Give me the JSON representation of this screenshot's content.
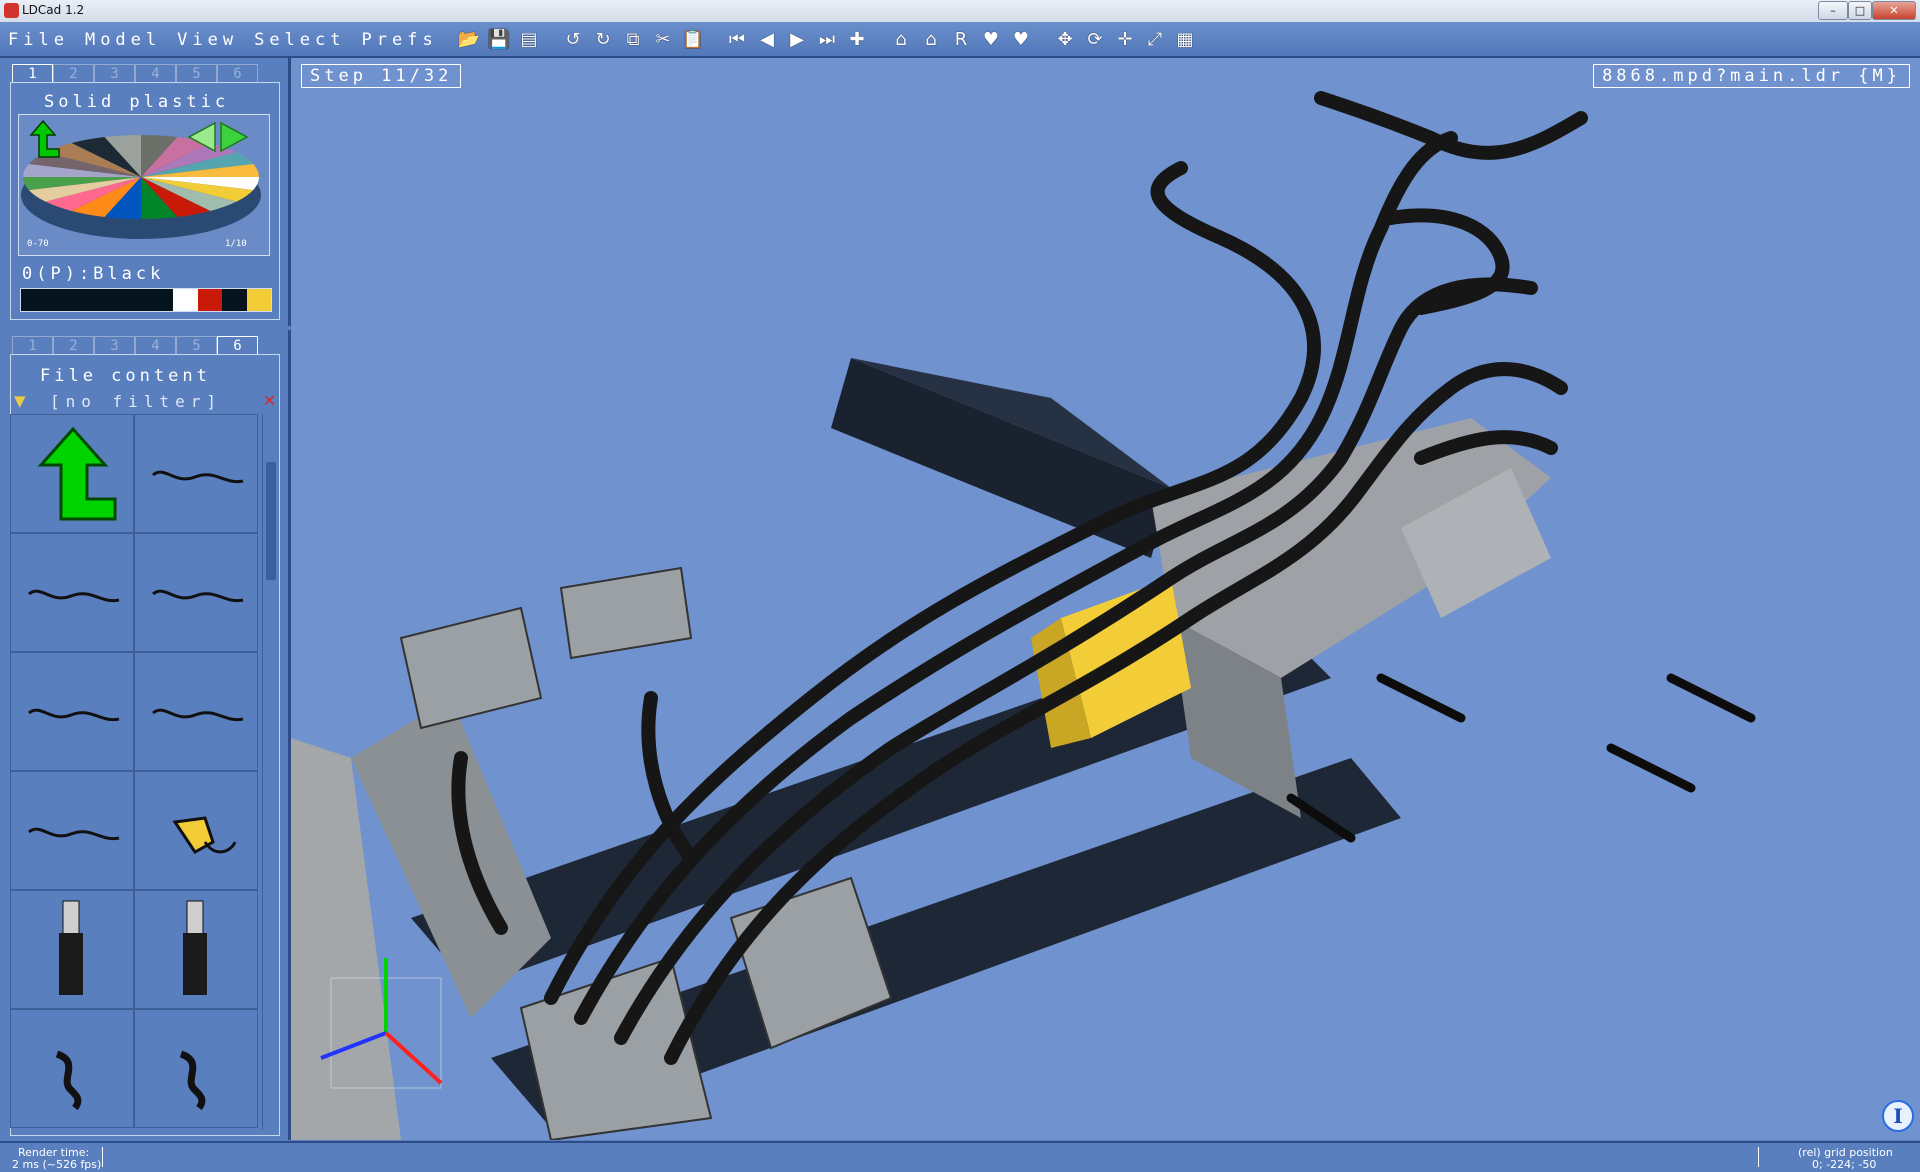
{
  "window": {
    "title": "LDCad 1.2",
    "controls": [
      "–",
      "□",
      "✕"
    ]
  },
  "menu": [
    "File",
    "Model",
    "View",
    "Select",
    "Prefs"
  ],
  "toolbar": {
    "icons": [
      "open-icon",
      "save-icon",
      "save-all-icon",
      "sep",
      "undo-icon",
      "redo-icon",
      "copy-icon",
      "cut-icon",
      "paste-icon",
      "sep",
      "first-step-icon",
      "prev-step-icon",
      "next-step-icon",
      "last-step-icon",
      "add-step-icon",
      "sep",
      "home-icon",
      "home-insert-icon",
      "reset-rotation-icon",
      "heart-icon",
      "heart-broken-icon",
      "sep",
      "move-icon",
      "rotate-icon",
      "pan-icon",
      "zoom-extents-icon",
      "grid-icon"
    ],
    "glyphs": [
      "📂",
      "💾",
      "▤",
      "",
      "↺",
      "↻",
      "⧉",
      "✂",
      "📋",
      "",
      "⏮",
      "◀",
      "▶",
      "⏭",
      "✚",
      "",
      "⌂",
      "⌂",
      "R",
      "♥",
      "♥",
      "",
      "✥",
      "⟳",
      "✛",
      "⤢",
      "▦"
    ]
  },
  "color_panel": {
    "tabs": [
      "1",
      "2",
      "3",
      "4",
      "5",
      "6"
    ],
    "active_tab": "1",
    "title": "Solid plastic",
    "range_min": "0-70",
    "range_max": "1/10",
    "selected_color": "0(P):Black",
    "swatches": [
      "#05131d",
      "#ffffff",
      "#c91a09",
      "#05131d",
      "#f2cd37"
    ],
    "swatch_weights": [
      50,
      8,
      8,
      8,
      8
    ]
  },
  "parts_panel": {
    "tabs": [
      "1",
      "2",
      "3",
      "4",
      "5",
      "6"
    ],
    "active_tab": "6",
    "title": "File content",
    "filter": "[no filter]",
    "items": [
      "green-arrow-icon",
      "hose-curve-icon",
      "hose-curve-icon",
      "hose-curve-icon",
      "hose-curve-icon",
      "hose-curve-icon",
      "hose-curve-icon",
      "hose-assembly-icon",
      "pneumatic-cylinder-icon",
      "pneumatic-cylinder-icon",
      "hose-short-icon",
      "hose-short-icon"
    ]
  },
  "viewport": {
    "step": "Step 11/32",
    "file": "8868.mpd?main.ldr {M}",
    "info": "I"
  },
  "status": {
    "render_label": "Render time:",
    "render_value": "2 ms (~526 fps)",
    "grid_label": "(rel) grid position",
    "grid_value": "0; -224; -50"
  },
  "colors": {
    "panel_bg": "#5a7fbf",
    "viewport_bg": "#7092cf",
    "border": "#2e4d86",
    "text": "#ffffff"
  }
}
